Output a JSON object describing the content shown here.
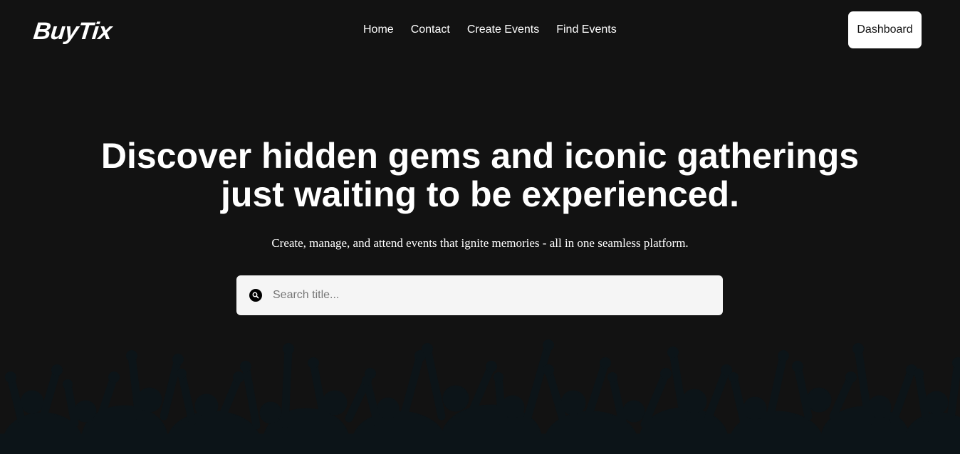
{
  "brand": {
    "logo_text": "BuyTix"
  },
  "nav": {
    "links": [
      "Home",
      "Contact",
      "Create Events",
      "Find Events"
    ],
    "dashboard_label": "Dashboard"
  },
  "hero": {
    "title_line1": "Discover hidden gems and iconic gatherings",
    "title_line2": "just waiting to be experienced.",
    "subtitle": "Create, manage, and attend events that ignite memories - all in one seamless platform.",
    "search_placeholder": "Search title..."
  },
  "icons": {
    "search": "search-icon"
  },
  "colors": {
    "background": "#121212",
    "text": "#ffffff",
    "button_bg": "#ffffff",
    "search_bg": "#f5f5f5",
    "crowd_silhouette": "#0c1418"
  }
}
